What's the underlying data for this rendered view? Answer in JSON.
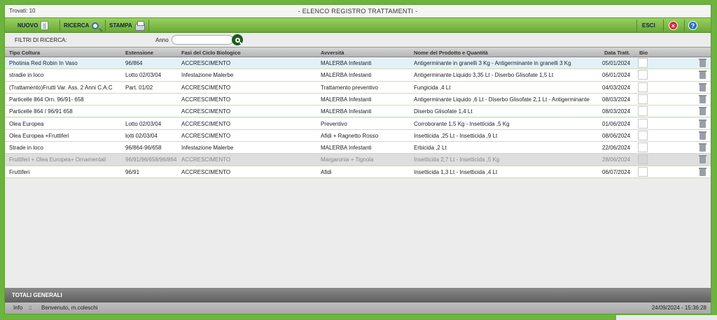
{
  "header": {
    "found": "Trovati: 10",
    "title": "- ELENCO REGISTRO TRATTAMENTI -"
  },
  "toolbar": {
    "new_label": "NUOVO",
    "search_label": "RICERCA",
    "print_label": "STAMPA",
    "exit_label": "ESCI"
  },
  "filters": {
    "title": "FILTRI DI RICERCA:",
    "year_label": "Anno",
    "year_value": ""
  },
  "table": {
    "columns": [
      "Tipo Coltura",
      "Estensione",
      "Fasi del Ciclo Biologico",
      "Avversità",
      "Nome del Prodotto e Quantità",
      "Data Tratt.",
      "Bio"
    ],
    "rows": [
      {
        "coltura": "Photinia Red Robin In Vaso",
        "estensione": "96/864",
        "fase": "ACCRESCIMENTO",
        "avversita": "MALERBA Infestanti",
        "prodotto": "Antigerminante in granelli 3 Kg - Antigerminante in granelli 3 Kg",
        "data": "05/01/2024"
      },
      {
        "coltura": "stradie in loco",
        "estensione": "Lotto 02/03/04",
        "fase": "Infestazione Malerbe",
        "avversita": "MALERBA Infestanti",
        "prodotto": "Antigerminante Liquido 3,35 Lt - Diserbo Glisofate 1,5 Lt",
        "data": "06/01/2024"
      },
      {
        "coltura": "(Trattamento)Frutti  Var. Ass. 2 Anni C.A.C",
        "estensione": "Part. 01/02",
        "fase": "ACCRESCIMENTO",
        "avversita": "Trattamento preventivo",
        "prodotto": "Fungicida ,4 Lt",
        "data": "04/03/2024"
      },
      {
        "coltura": "Particelle 864 Orn. 96/91- 658",
        "estensione": "",
        "fase": "ACCRESCIMENTO",
        "avversita": "MALERBA Infestanti",
        "prodotto": "Antigerminante Liquido ,6 Lt - Diserbo Glisofate 2,1 Lt - Antigerminante",
        "data": "08/03/2024"
      },
      {
        "coltura": "Particelle 864  /  96/91  658",
        "estensione": "",
        "fase": "ACCRESCIMENTO",
        "avversita": "MALERBA Infestanti",
        "prodotto": "Diserbo Glisofate 1,4 Lt",
        "data": "08/03/2024"
      },
      {
        "coltura": "Olea Europea",
        "estensione": "Lotto 02/03/04",
        "fase": "ACCRESCIMENTO",
        "avversita": "Preventivo",
        "prodotto": "Corroborante 1,5 Kg - Insetticida ,5 Kg",
        "data": "01/06/2024"
      },
      {
        "coltura": "Olea Europea  +Fruttiferi",
        "estensione": "lotti 02/03/04",
        "fase": "ACCRESCIMENTO",
        "avversita": "Afidi + Ragnetto Rosso",
        "prodotto": "Insetticida ,25 Lt - Insetticida ,9 Lt",
        "data": "08/06/2024"
      },
      {
        "coltura": "Strade in loco",
        "estensione": "96/864-96/658",
        "fase": "Infestazione Malerbe",
        "avversita": "MALERBA Infestanti",
        "prodotto": "Erbicida ,2 Lt",
        "data": "22/06/2024"
      },
      {
        "coltura": "Fruttiferi + Olea Europea+ Ornamentali",
        "estensione": "96/91/96/658/96/864",
        "fase": "ACCRESCIMENTO",
        "avversita": "Margaronia + Tignola",
        "prodotto": "Insetticida 2,7 Lt - Insetticida ,5 Kg",
        "data": "28/06/2024"
      },
      {
        "coltura": "Fruttiferi",
        "estensione": "96/91",
        "fase": "ACCRESCIMENTO",
        "avversita": "Afidi",
        "prodotto": "Insetticida 1,3 Lt - Insetticida ,4 Lt",
        "data": "06/07/2024"
      }
    ]
  },
  "footer": {
    "totals_label": "TOTALI GENERALI",
    "info_label": "Info",
    "info_sep": "::",
    "welcome": "Benvenuto, m.coleschi",
    "timestamp": "24/09/2024 - 15:36:28"
  },
  "icons": {
    "new": "new-document-icon",
    "search": "magnifier-icon",
    "print": "printer-icon",
    "close": "close-icon",
    "help": "help-icon",
    "delete": "trash-icon"
  },
  "colors": {
    "accent_green": "#6db33f",
    "row_border": "#c7dfb7",
    "selected_row": "#e4f0f8"
  }
}
